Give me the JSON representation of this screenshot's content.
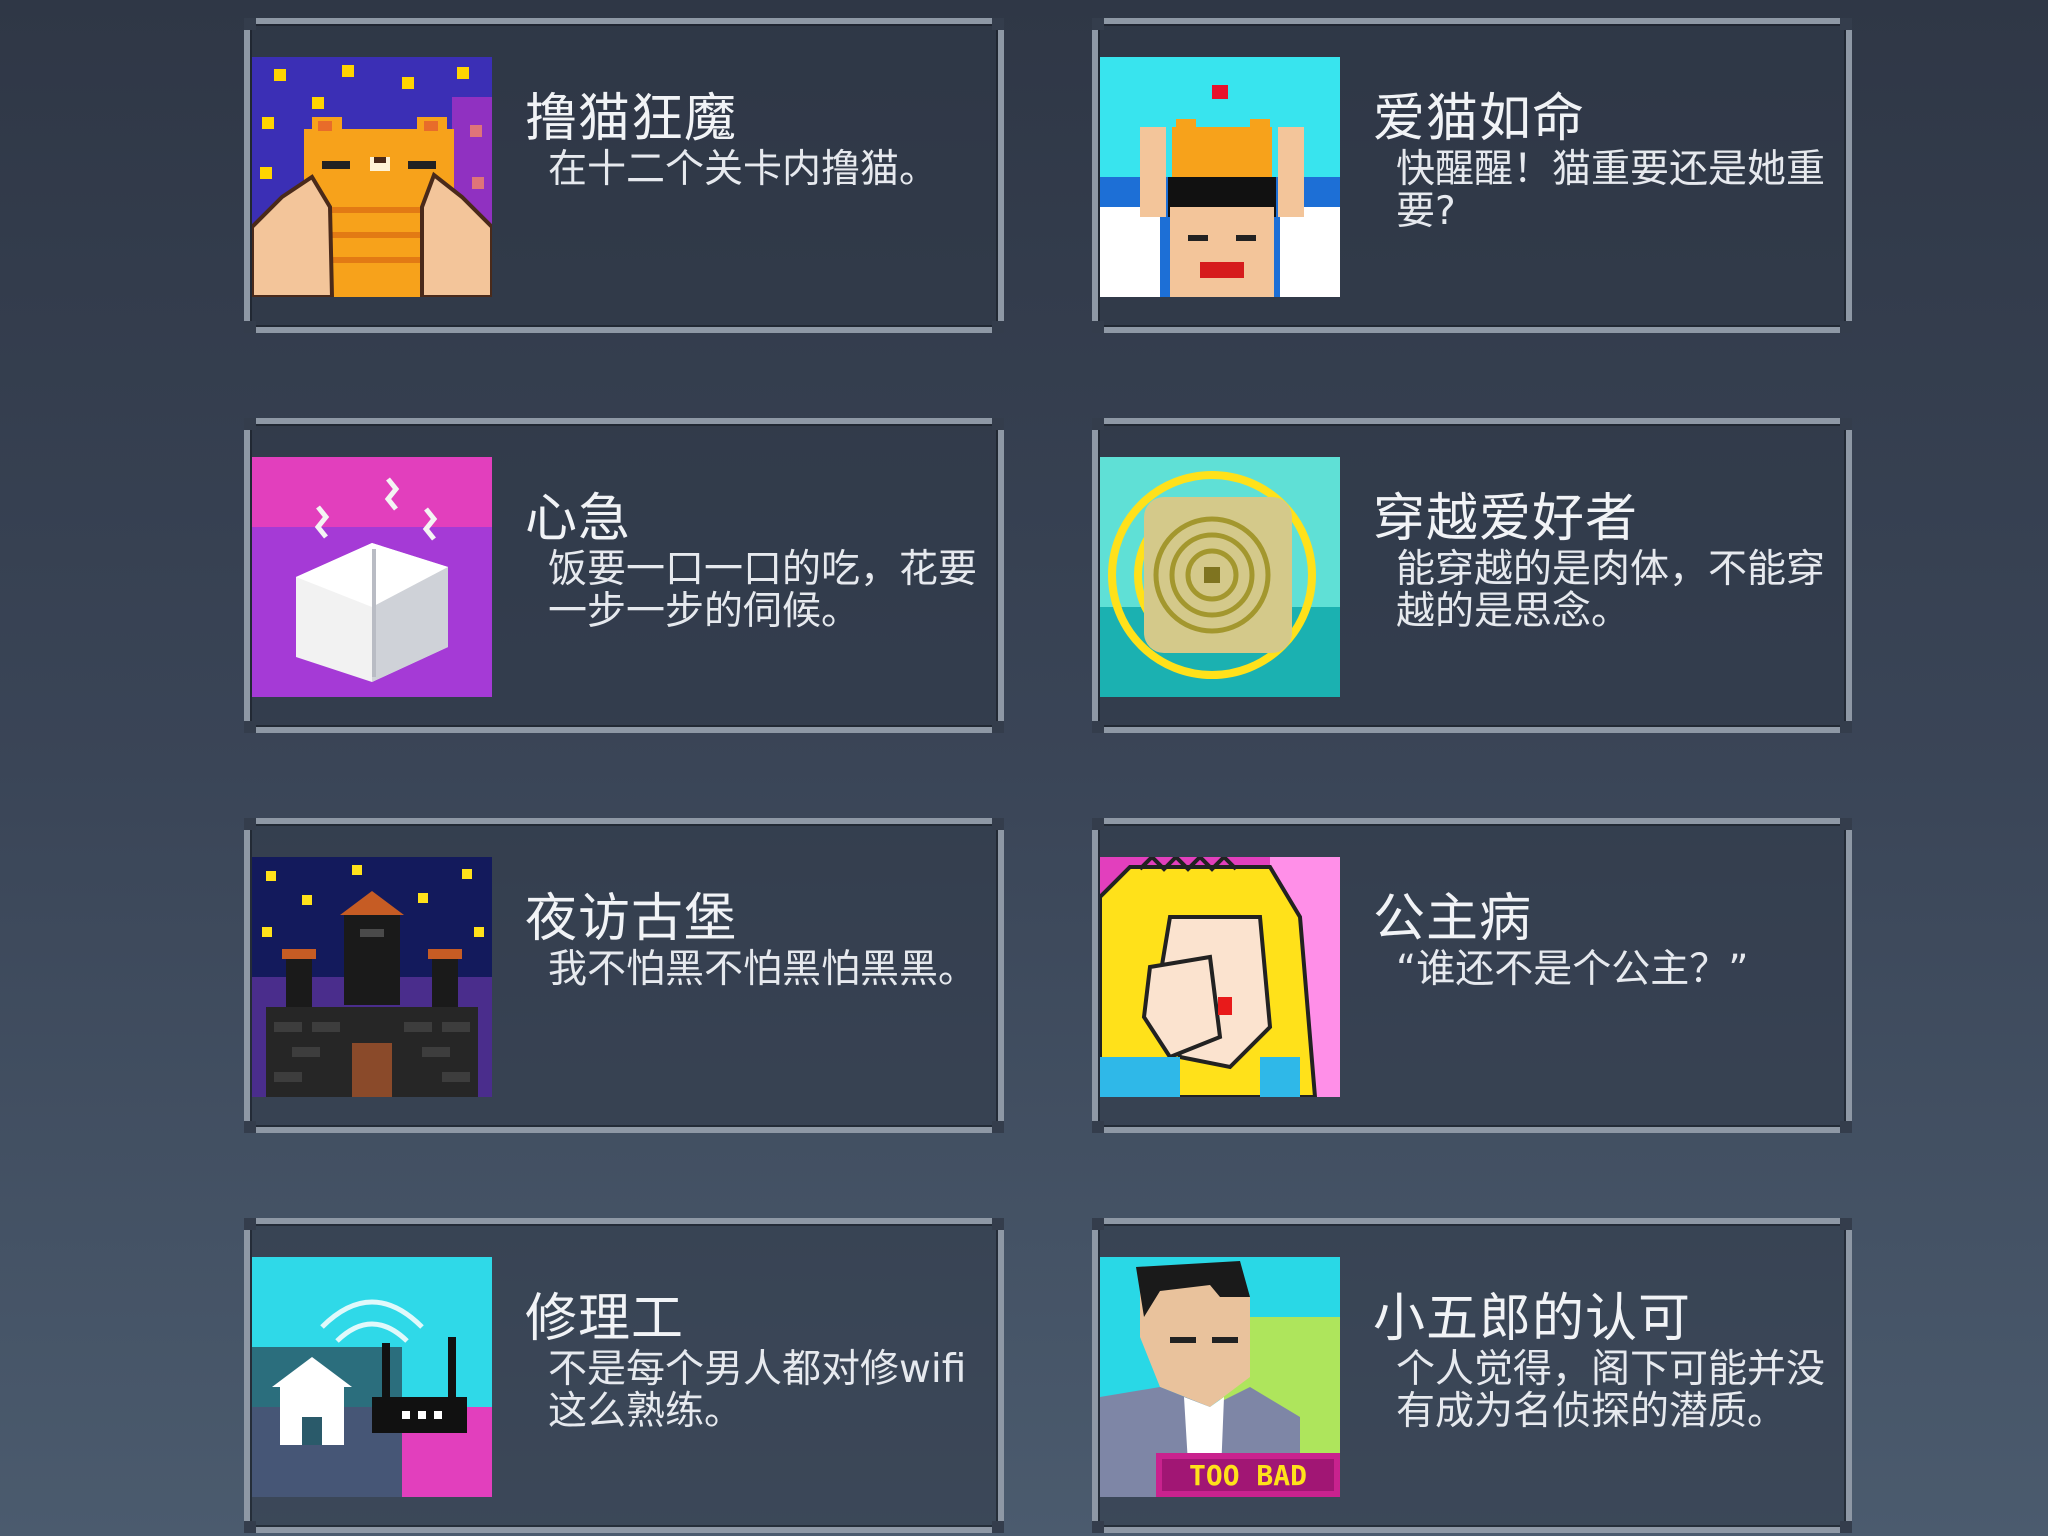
{
  "achievements": [
    {
      "title": "撸猫狂魔",
      "description": "在十二个关卡内撸猫。",
      "icon": "cat-petting-icon"
    },
    {
      "title": "爱猫如命",
      "description": "快醒醒！猫重要还是她重要?",
      "icon": "cat-on-head-icon"
    },
    {
      "title": "心急",
      "description": "饭要一口一口的吃，花要一步一步的伺候。",
      "icon": "steaming-tofu-icon"
    },
    {
      "title": "穿越爱好者",
      "description": "能穿越的是肉体，不能穿越的是思念。",
      "icon": "time-portal-icon"
    },
    {
      "title": "夜访古堡",
      "description": "我不怕黑不怕黑怕黑黑。",
      "icon": "night-castle-icon"
    },
    {
      "title": "公主病",
      "description": "“谁还不是个公主？”",
      "icon": "crying-princess-icon"
    },
    {
      "title": "修理工",
      "description": "不是每个男人都对修wifi这么熟练。",
      "icon": "wifi-router-icon"
    },
    {
      "title": "小五郎的认可",
      "description": "个人觉得，阁下可能并没有成为名侦探的潜质。",
      "icon": "detective-too-bad-icon",
      "badge": "TOO BAD"
    }
  ]
}
